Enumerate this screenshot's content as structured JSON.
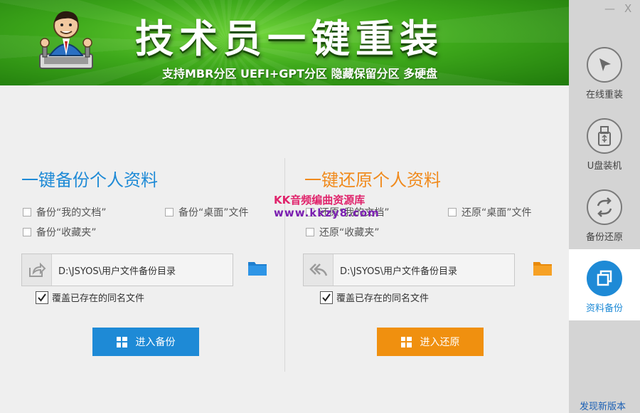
{
  "banner": {
    "title": "技术员一键重装",
    "subtitle": "支持MBR分区 UEFI+GPT分区 隐藏保留分区 多硬盘"
  },
  "watermark": {
    "line1": "KK音频编曲资源库",
    "line2": "www.kkzy8.com"
  },
  "window": {
    "minimize": "—",
    "close": "X"
  },
  "sidebar": {
    "items": [
      {
        "label": "在线重装",
        "icon": "cursor-icon",
        "active": false
      },
      {
        "label": "U盘装机",
        "icon": "usb-icon",
        "active": false
      },
      {
        "label": "备份还原",
        "icon": "sync-icon",
        "active": false
      },
      {
        "label": "资料备份",
        "icon": "copy-icon",
        "active": true
      }
    ],
    "new_version": "发现新版本"
  },
  "backup": {
    "title": "一键备份个人资料",
    "options": [
      "备份“我的文档”",
      "备份“桌面”文件",
      "备份“收藏夹”"
    ],
    "path": "D:\\JSYOS\\用户文件备份目录",
    "overwrite_label": "覆盖已存在的同名文件",
    "overwrite_checked": true,
    "button": "进入备份"
  },
  "restore": {
    "title": "一键还原个人资料",
    "options": [
      "还原“我的文档”",
      "还原“桌面”文件",
      "还原“收藏夹”"
    ],
    "path": "D:\\JSYOS\\用户文件备份目录",
    "overwrite_label": "覆盖已存在的同名文件",
    "overwrite_checked": true,
    "button": "进入还原"
  },
  "colors": {
    "accent_blue": "#1e8ad6",
    "accent_orange": "#f0900f",
    "banner_green": "#3ea91b"
  }
}
